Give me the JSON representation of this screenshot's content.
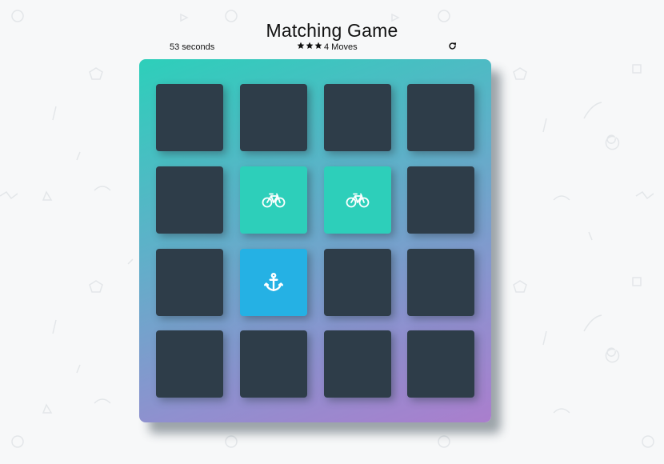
{
  "header": {
    "title": "Matching Game"
  },
  "score_panel": {
    "timer_text": "53 seconds",
    "stars_count": 3,
    "moves_text": "4 Moves",
    "restart_icon": "restart-icon"
  },
  "deck": {
    "rows": 4,
    "columns": 4,
    "cards": [
      {
        "state": "closed",
        "icon": ""
      },
      {
        "state": "closed",
        "icon": ""
      },
      {
        "state": "closed",
        "icon": ""
      },
      {
        "state": "closed",
        "icon": ""
      },
      {
        "state": "closed",
        "icon": ""
      },
      {
        "state": "match",
        "icon": "bicycle-icon"
      },
      {
        "state": "match",
        "icon": "bicycle-icon"
      },
      {
        "state": "closed",
        "icon": ""
      },
      {
        "state": "closed",
        "icon": ""
      },
      {
        "state": "open",
        "icon": "anchor-icon"
      },
      {
        "state": "closed",
        "icon": ""
      },
      {
        "state": "closed",
        "icon": ""
      },
      {
        "state": "closed",
        "icon": ""
      },
      {
        "state": "closed",
        "icon": ""
      },
      {
        "state": "closed",
        "icon": ""
      },
      {
        "state": "closed",
        "icon": ""
      }
    ]
  },
  "colors": {
    "page_background": "#f7f8f9",
    "card_closed": "#2e3d49",
    "card_match": "#2dcfba",
    "card_open": "#25b1e4",
    "deck_gradient_start": "#2dcfba",
    "deck_gradient_end": "#aa7ecd"
  }
}
